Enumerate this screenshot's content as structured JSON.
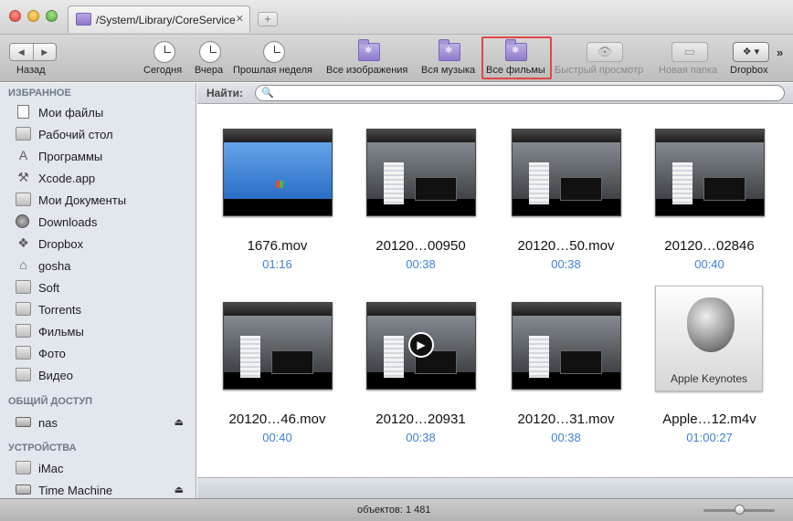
{
  "window": {
    "tab_title": "/System/Library/CoreServices",
    "tab_close_glyph": "✕",
    "tab_add_glyph": "+"
  },
  "toolbar": {
    "back_label": "Назад",
    "back_glyph": "◀",
    "forward_glyph": "▶",
    "items": [
      {
        "label": "Сегодня",
        "icon": "clock-icon"
      },
      {
        "label": "Вчера",
        "icon": "clock-icon"
      },
      {
        "label": "Прошлая неделя",
        "icon": "clock-icon"
      },
      {
        "label": "Все изображения",
        "icon": "smart-folder-icon"
      },
      {
        "label": "Вся музыка",
        "icon": "smart-folder-icon"
      },
      {
        "label": "Все фильмы",
        "icon": "smart-folder-icon",
        "highlighted": true
      },
      {
        "label": "Быстрый просмотр",
        "icon": "eye-icon",
        "disabled": true
      },
      {
        "label": "Новая папка",
        "icon": "new-folder-icon",
        "disabled": true
      },
      {
        "label": "Dropbox",
        "icon": "dropbox-icon"
      }
    ],
    "quicklook_glyph": "👁",
    "newfolder_glyph": "▭",
    "dropbox_glyph": "❖ ▾",
    "overflow_glyph": "»",
    "highlight_color": "#e34545"
  },
  "sidebar": {
    "favorites_header": "ИЗБРАННОЕ",
    "favorites": [
      {
        "label": "Мои файлы",
        "icon": "all-files-icon"
      },
      {
        "label": "Рабочий стол",
        "icon": "desktop-icon"
      },
      {
        "label": "Программы",
        "icon": "applications-icon"
      },
      {
        "label": "Xcode.app",
        "icon": "xcode-icon"
      },
      {
        "label": "Мои Документы",
        "icon": "folder-icon"
      },
      {
        "label": "Downloads",
        "icon": "downloads-icon"
      },
      {
        "label": "Dropbox",
        "icon": "dropbox-icon"
      },
      {
        "label": "gosha",
        "icon": "home-icon"
      },
      {
        "label": "Soft",
        "icon": "folder-icon"
      },
      {
        "label": "Torrents",
        "icon": "folder-icon"
      },
      {
        "label": "Фильмы",
        "icon": "folder-icon"
      },
      {
        "label": "Фото",
        "icon": "folder-icon"
      },
      {
        "label": "Видео",
        "icon": "folder-icon"
      }
    ],
    "shared_header": "ОБЩИЙ ДОСТУП",
    "shared": [
      {
        "label": "nas",
        "icon": "network-drive-icon"
      }
    ],
    "devices_header": "УСТРОЙСТВА",
    "devices": [
      {
        "label": "iMac",
        "icon": "imac-icon"
      },
      {
        "label": "Time Machine",
        "icon": "drive-icon"
      }
    ],
    "eject_glyph": "⏏"
  },
  "search": {
    "label": "Найти:",
    "placeholder": "",
    "value": "",
    "magnifier_glyph": "🔍"
  },
  "files": [
    {
      "name": "1676.mov",
      "duration": "01:16",
      "thumb": "desktop"
    },
    {
      "name": "20120…00950",
      "duration": "00:38",
      "thumb": "screen"
    },
    {
      "name": "20120…50.mov",
      "duration": "00:38",
      "thumb": "screen"
    },
    {
      "name": "20120…02846",
      "duration": "00:40",
      "thumb": "screen"
    },
    {
      "name": "20120…46.mov",
      "duration": "00:40",
      "thumb": "screen"
    },
    {
      "name": "20120…20931",
      "duration": "00:38",
      "thumb": "play"
    },
    {
      "name": "20120…31.mov",
      "duration": "00:38",
      "thumb": "screen"
    },
    {
      "name": "Apple…12.m4v",
      "duration": "01:00:27",
      "thumb": "apple",
      "thumb_text": "Apple Keynotes"
    }
  ],
  "status": {
    "count": "объектов: 1 481",
    "play_glyph": "▶"
  }
}
